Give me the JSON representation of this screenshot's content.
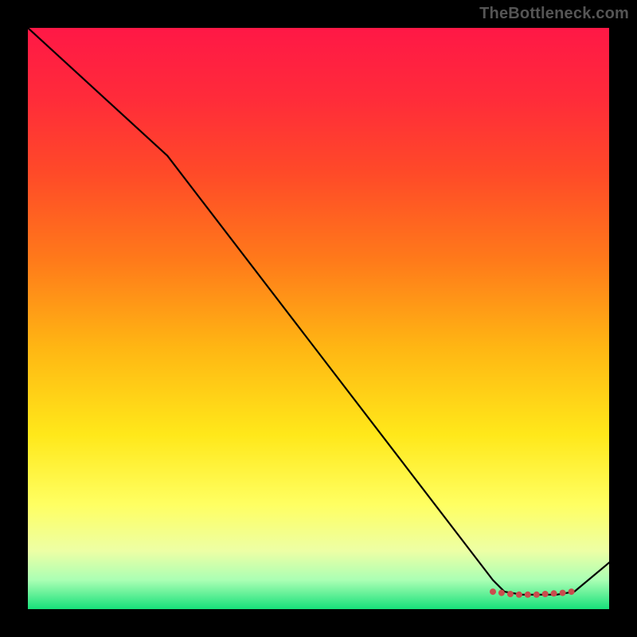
{
  "watermark": "TheBottleneck.com",
  "chart_data": {
    "type": "line",
    "title": "",
    "xlabel": "",
    "ylabel": "",
    "xlim": [
      0,
      100
    ],
    "ylim": [
      0,
      100
    ],
    "grid": false,
    "legend": false,
    "gradient_stops": [
      {
        "offset": 0.0,
        "color": "#ff1846"
      },
      {
        "offset": 0.12,
        "color": "#ff2b3a"
      },
      {
        "offset": 0.25,
        "color": "#ff4a28"
      },
      {
        "offset": 0.4,
        "color": "#ff7a1a"
      },
      {
        "offset": 0.55,
        "color": "#ffb613"
      },
      {
        "offset": 0.7,
        "color": "#ffe81a"
      },
      {
        "offset": 0.82,
        "color": "#ffff62"
      },
      {
        "offset": 0.9,
        "color": "#edffa5"
      },
      {
        "offset": 0.95,
        "color": "#aaffb4"
      },
      {
        "offset": 1.0,
        "color": "#17e07a"
      }
    ],
    "series": [
      {
        "name": "trace",
        "x": [
          0,
          24,
          80,
          82,
          85,
          88,
          91,
          94,
          100
        ],
        "y": [
          100,
          78,
          5,
          3,
          2.5,
          2.5,
          2.5,
          3,
          8
        ]
      }
    ],
    "markers": {
      "name": "bottom-cluster",
      "color": "#c94d4d",
      "x": [
        80,
        81.5,
        83,
        84.5,
        86,
        87.5,
        89,
        90.5,
        92,
        93.5
      ],
      "y": [
        3,
        2.8,
        2.6,
        2.5,
        2.5,
        2.5,
        2.6,
        2.7,
        2.8,
        3
      ]
    }
  }
}
